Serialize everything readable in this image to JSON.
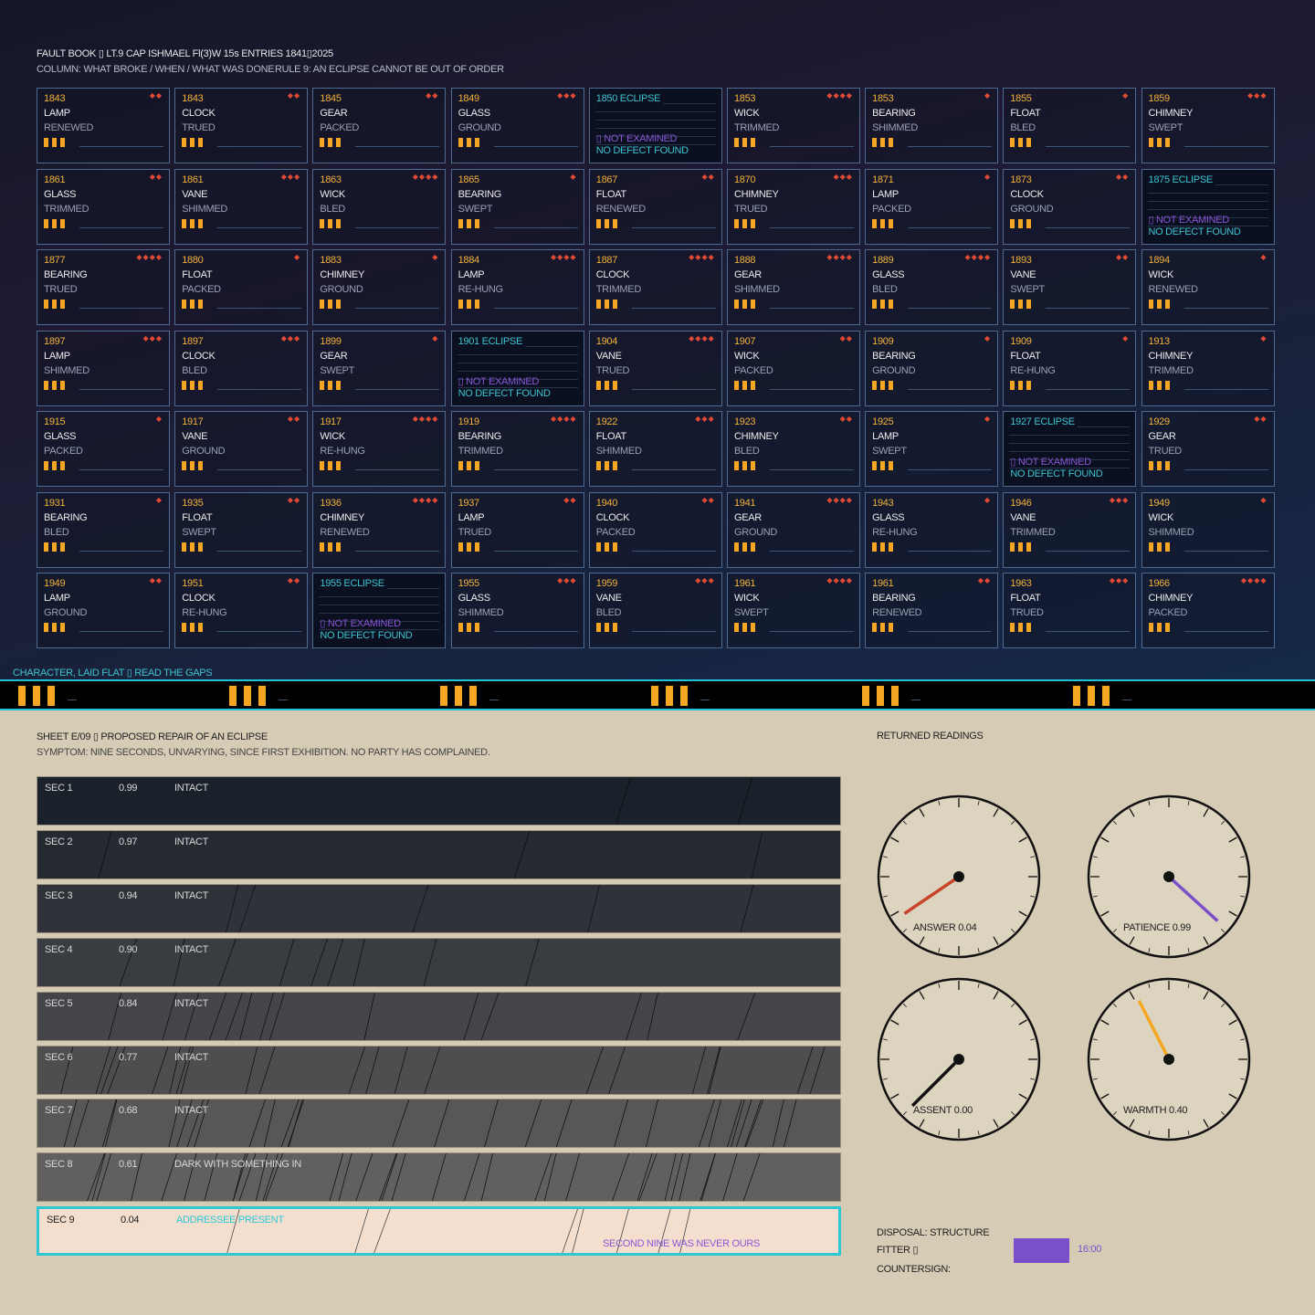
{
  "header": {
    "line1": "FAULT BOOK ▯ LT.9 CAP ISHMAEL  Fl(3)W 15s  ENTRIES 1841▯2025",
    "line2_left": "COLUMN: WHAT BROKE / WHEN / WHAT WAS DONE",
    "line2_right": "RULE 9: AN ECLIPSE CANNOT BE OUT OF ORDER"
  },
  "eclipse_labels": {
    "tag": "ECLIPSE",
    "not_examined": "▯ NOT EXAMINED",
    "no_defect": "NO DEFECT FOUND"
  },
  "entries": [
    {
      "year": "1843",
      "part": "LAMP",
      "action": "RENEWED",
      "severity": 2
    },
    {
      "year": "1843",
      "part": "CLOCK",
      "action": "TRUED",
      "severity": 2
    },
    {
      "year": "1845",
      "part": "GEAR",
      "action": "PACKED",
      "severity": 2
    },
    {
      "year": "1849",
      "part": "GLASS",
      "action": "GROUND",
      "severity": 3
    },
    {
      "year": "1850",
      "eclipse": true
    },
    {
      "year": "1853",
      "part": "WICK",
      "action": "TRIMMED",
      "severity": 4
    },
    {
      "year": "1853",
      "part": "BEARING",
      "action": "SHIMMED",
      "severity": 1
    },
    {
      "year": "1855",
      "part": "FLOAT",
      "action": "BLED",
      "severity": 1
    },
    {
      "year": "1859",
      "part": "CHIMNEY",
      "action": "SWEPT",
      "severity": 3
    },
    {
      "year": "1861",
      "part": "GLASS",
      "action": "TRIMMED",
      "severity": 2
    },
    {
      "year": "1861",
      "part": "VANE",
      "action": "SHIMMED",
      "severity": 3
    },
    {
      "year": "1863",
      "part": "WICK",
      "action": "BLED",
      "severity": 4
    },
    {
      "year": "1865",
      "part": "BEARING",
      "action": "SWEPT",
      "severity": 1
    },
    {
      "year": "1867",
      "part": "FLOAT",
      "action": "RENEWED",
      "severity": 2
    },
    {
      "year": "1870",
      "part": "CHIMNEY",
      "action": "TRUED",
      "severity": 3
    },
    {
      "year": "1871",
      "part": "LAMP",
      "action": "PACKED",
      "severity": 1
    },
    {
      "year": "1873",
      "part": "CLOCK",
      "action": "GROUND",
      "severity": 2
    },
    {
      "year": "1875",
      "eclipse": true
    },
    {
      "year": "1877",
      "part": "BEARING",
      "action": "TRUED",
      "severity": 4
    },
    {
      "year": "1880",
      "part": "FLOAT",
      "action": "PACKED",
      "severity": 1
    },
    {
      "year": "1883",
      "part": "CHIMNEY",
      "action": "GROUND",
      "severity": 1
    },
    {
      "year": "1884",
      "part": "LAMP",
      "action": "RE-HUNG",
      "severity": 4
    },
    {
      "year": "1887",
      "part": "CLOCK",
      "action": "TRIMMED",
      "severity": 4
    },
    {
      "year": "1888",
      "part": "GEAR",
      "action": "SHIMMED",
      "severity": 4
    },
    {
      "year": "1889",
      "part": "GLASS",
      "action": "BLED",
      "severity": 4
    },
    {
      "year": "1893",
      "part": "VANE",
      "action": "SWEPT",
      "severity": 2
    },
    {
      "year": "1894",
      "part": "WICK",
      "action": "RENEWED",
      "severity": 1
    },
    {
      "year": "1897",
      "part": "LAMP",
      "action": "SHIMMED",
      "severity": 3
    },
    {
      "year": "1897",
      "part": "CLOCK",
      "action": "BLED",
      "severity": 3
    },
    {
      "year": "1899",
      "part": "GEAR",
      "action": "SWEPT",
      "severity": 1
    },
    {
      "year": "1901",
      "eclipse": true
    },
    {
      "year": "1904",
      "part": "VANE",
      "action": "TRUED",
      "severity": 4
    },
    {
      "year": "1907",
      "part": "WICK",
      "action": "PACKED",
      "severity": 2
    },
    {
      "year": "1909",
      "part": "BEARING",
      "action": "GROUND",
      "severity": 1
    },
    {
      "year": "1909",
      "part": "FLOAT",
      "action": "RE-HUNG",
      "severity": 1
    },
    {
      "year": "1913",
      "part": "CHIMNEY",
      "action": "TRIMMED",
      "severity": 1
    },
    {
      "year": "1915",
      "part": "GLASS",
      "action": "PACKED",
      "severity": 1
    },
    {
      "year": "1917",
      "part": "VANE",
      "action": "GROUND",
      "severity": 2
    },
    {
      "year": "1917",
      "part": "WICK",
      "action": "RE-HUNG",
      "severity": 4
    },
    {
      "year": "1919",
      "part": "BEARING",
      "action": "TRIMMED",
      "severity": 4
    },
    {
      "year": "1922",
      "part": "FLOAT",
      "action": "SHIMMED",
      "severity": 3
    },
    {
      "year": "1923",
      "part": "CHIMNEY",
      "action": "BLED",
      "severity": 2
    },
    {
      "year": "1925",
      "part": "LAMP",
      "action": "SWEPT",
      "severity": 1
    },
    {
      "year": "1927",
      "eclipse": true
    },
    {
      "year": "1929",
      "part": "GEAR",
      "action": "TRUED",
      "severity": 2
    },
    {
      "year": "1931",
      "part": "BEARING",
      "action": "BLED",
      "severity": 1
    },
    {
      "year": "1935",
      "part": "FLOAT",
      "action": "SWEPT",
      "severity": 2
    },
    {
      "year": "1936",
      "part": "CHIMNEY",
      "action": "RENEWED",
      "severity": 4
    },
    {
      "year": "1937",
      "part": "LAMP",
      "action": "TRUED",
      "severity": 2
    },
    {
      "year": "1940",
      "part": "CLOCK",
      "action": "PACKED",
      "severity": 2
    },
    {
      "year": "1941",
      "part": "GEAR",
      "action": "GROUND",
      "severity": 4
    },
    {
      "year": "1943",
      "part": "GLASS",
      "action": "RE-HUNG",
      "severity": 1
    },
    {
      "year": "1946",
      "part": "VANE",
      "action": "TRIMMED",
      "severity": 3
    },
    {
      "year": "1949",
      "part": "WICK",
      "action": "SHIMMED",
      "severity": 1
    },
    {
      "year": "1949",
      "part": "LAMP",
      "action": "GROUND",
      "severity": 2
    },
    {
      "year": "1951",
      "part": "CLOCK",
      "action": "RE-HUNG",
      "severity": 2
    },
    {
      "year": "1955",
      "eclipse": true
    },
    {
      "year": "1955",
      "part": "GLASS",
      "action": "SHIMMED",
      "severity": 3
    },
    {
      "year": "1959",
      "part": "VANE",
      "action": "BLED",
      "severity": 3
    },
    {
      "year": "1961",
      "part": "WICK",
      "action": "SWEPT",
      "severity": 4
    },
    {
      "year": "1961",
      "part": "BEARING",
      "action": "RENEWED",
      "severity": 2
    },
    {
      "year": "1963",
      "part": "FLOAT",
      "action": "TRUED",
      "severity": 3
    },
    {
      "year": "1966",
      "part": "CHIMNEY",
      "action": "PACKED",
      "severity": 4
    }
  ],
  "band": {
    "label": "CHARACTER, LAID FLAT ▯ READ THE GAPS",
    "groups": 6,
    "flashes_per_group": 3
  },
  "sheet": {
    "title": "SHEET E/09 ▯ PROPOSED REPAIR OF AN ECLIPSE",
    "symptom": "SYMPTOM: NINE SECONDS, UNVARYING, SINCE FIRST EXHIBITION. NO PARTY HAS COMPLAINED.",
    "sections": [
      {
        "label": "SEC 1",
        "value": "0.99",
        "status": "INTACT"
      },
      {
        "label": "SEC 2",
        "value": "0.97",
        "status": "INTACT"
      },
      {
        "label": "SEC 3",
        "value": "0.94",
        "status": "INTACT"
      },
      {
        "label": "SEC 4",
        "value": "0.90",
        "status": "INTACT"
      },
      {
        "label": "SEC 5",
        "value": "0.84",
        "status": "INTACT"
      },
      {
        "label": "SEC 6",
        "value": "0.77",
        "status": "INTACT"
      },
      {
        "label": "SEC 7",
        "value": "0.68",
        "status": "INTACT"
      },
      {
        "label": "SEC 8",
        "value": "0.61",
        "status": "DARK WITH SOMETHING IN"
      },
      {
        "label": "SEC 9",
        "value": "0.04",
        "status": "ADDRESSEE PRESENT",
        "note": "SECOND NINE WAS NEVER OURS"
      }
    ]
  },
  "readings": {
    "title": "RETURNED READINGS",
    "gauges": [
      {
        "label": "ANSWER 0.04",
        "value": 0.04,
        "color": "#c8432a"
      },
      {
        "label": "PATIENCE 0.99",
        "value": 0.99,
        "color": "#7b4fc9"
      },
      {
        "label": "ASSENT 0.00",
        "value": 0.0,
        "color": "#111111"
      },
      {
        "label": "WARMTH 0.40",
        "value": 0.4,
        "color": "#f5a623"
      }
    ]
  },
  "disposal": {
    "line1": "DISPOSAL: STRUCTURE",
    "fitter": "FITTER ▯",
    "countersign": "COUNTERSIGN:",
    "time": "16:00",
    "swatch_color": "#7b4fc9"
  }
}
